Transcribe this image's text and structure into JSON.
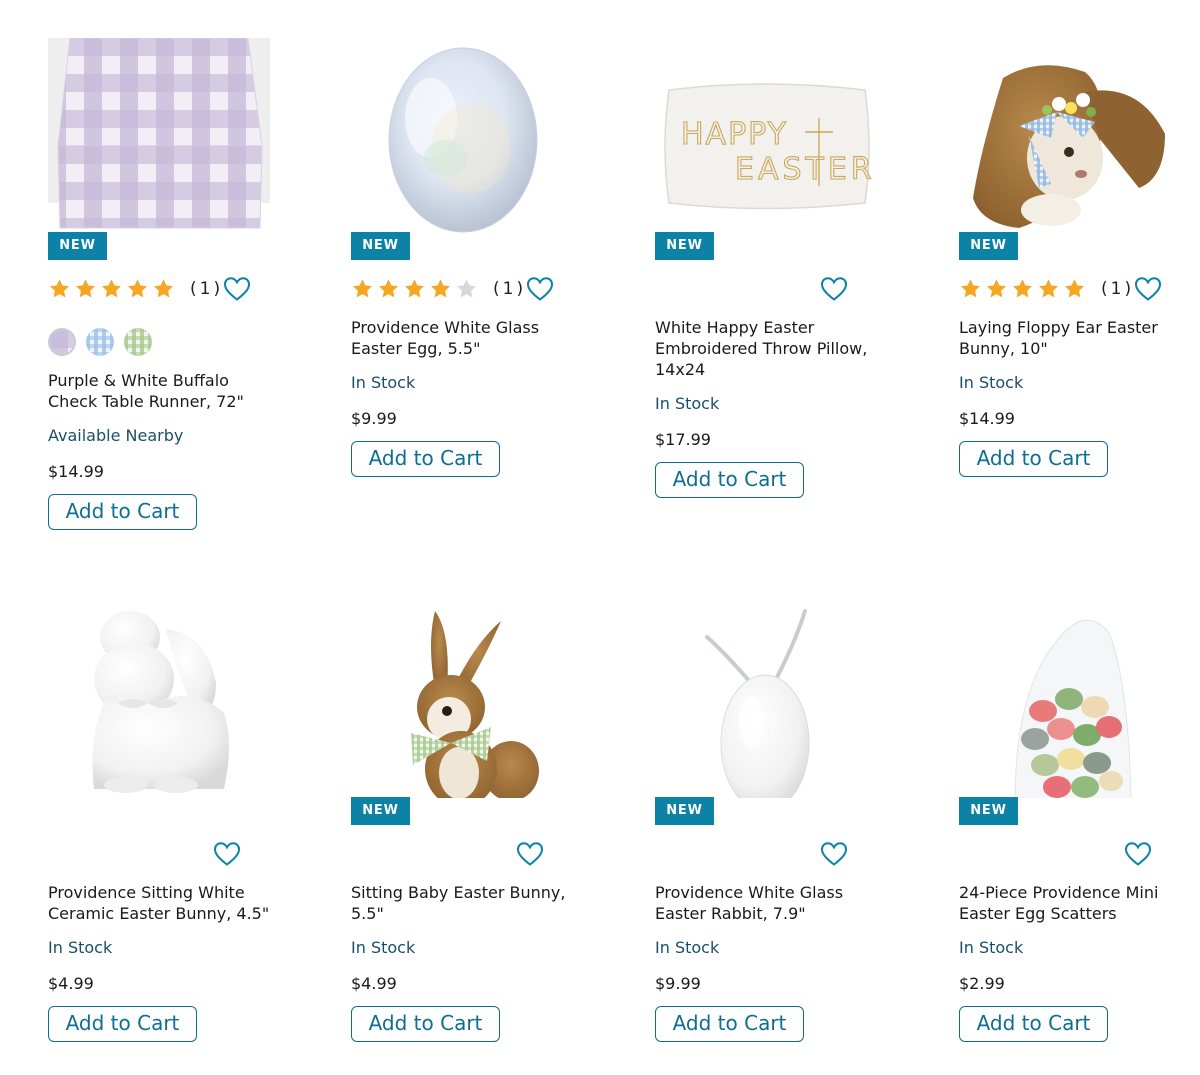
{
  "colors": {
    "accent": "#0b82a6",
    "button": "#0b6f93",
    "stock_text": "#1b4e6b",
    "star": "#f5a623",
    "star_empty": "#d8d8d8"
  },
  "icons": {
    "favorite": "heart-outline-icon",
    "rating": "star-icon"
  },
  "products": [
    {
      "title": "Purple & White Buffalo Check Table Runner, 72\"",
      "badge": "NEW",
      "rating_stars": 5,
      "rating_count": "(1)",
      "swatches": [
        "purple-check",
        "blue-check",
        "green-check"
      ],
      "stock": "Available Nearby",
      "price": "$14.99",
      "cta": "Add to Cart"
    },
    {
      "title": "Providence White Glass Easter Egg, 5.5\"",
      "badge": "NEW",
      "rating_stars": 4,
      "rating_count": "(1)",
      "stock": "In Stock",
      "price": "$9.99",
      "cta": "Add to Cart"
    },
    {
      "title": "White Happy Easter Embroidered Throw Pillow, 14x24",
      "badge": "NEW",
      "image_text": {
        "line1": "HAPPY",
        "line2": "EASTER"
      },
      "stock": "In Stock",
      "price": "$17.99",
      "cta": "Add to Cart"
    },
    {
      "title": "Laying Floppy Ear Easter Bunny, 10\"",
      "badge": "NEW",
      "rating_stars": 5,
      "rating_count": "(1)",
      "stock": "In Stock",
      "price": "$14.99",
      "cta": "Add to Cart"
    },
    {
      "title": "Providence Sitting White Ceramic Easter Bunny, 4.5\"",
      "stock": "In Stock",
      "price": "$4.99",
      "cta": "Add to Cart"
    },
    {
      "title": "Sitting Baby Easter Bunny, 5.5\"",
      "badge": "NEW",
      "stock": "In Stock",
      "price": "$4.99",
      "cta": "Add to Cart"
    },
    {
      "title": "Providence White Glass Easter Rabbit, 7.9\"",
      "badge": "NEW",
      "stock": "In Stock",
      "price": "$9.99",
      "cta": "Add to Cart"
    },
    {
      "title": "24-Piece Providence Mini Easter Egg Scatters",
      "badge": "NEW",
      "stock": "In Stock",
      "price": "$2.99",
      "cta": "Add to Cart"
    }
  ]
}
